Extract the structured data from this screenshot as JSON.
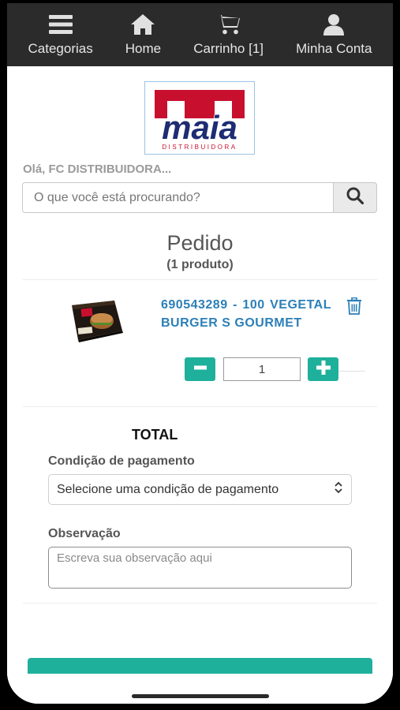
{
  "nav": {
    "items": [
      {
        "label": "Categorias",
        "icon": "menu-icon"
      },
      {
        "label": "Home",
        "icon": "home-icon"
      },
      {
        "label": "Carrinho [1]",
        "icon": "cart-icon"
      },
      {
        "label": "Minha Conta",
        "icon": "user-icon"
      }
    ]
  },
  "logo": {
    "brand": "maia",
    "tagline": "DISTRIBUIDORA",
    "colors": {
      "red": "#c8102e",
      "navy": "#1d2c73"
    }
  },
  "greeting": "Olá, FC DISTRIBUIDORA...",
  "search": {
    "placeholder": "O que você está procurando?",
    "value": ""
  },
  "order": {
    "title": "Pedido",
    "subtitle": "(1 produto)",
    "items": [
      {
        "name": "690543289 - 100 VEGETAL BURGER S GOURMET",
        "quantity": "1"
      }
    ]
  },
  "total_label": "TOTAL",
  "payment": {
    "label": "Condição de pagamento",
    "selected": "Selecione uma condição de pagamento"
  },
  "observation": {
    "label": "Observação",
    "placeholder": "Escreva sua observação aqui"
  },
  "colors": {
    "accent": "#1fb09c",
    "link": "#2c7fb8",
    "nav_bg": "#2b2b2b"
  }
}
